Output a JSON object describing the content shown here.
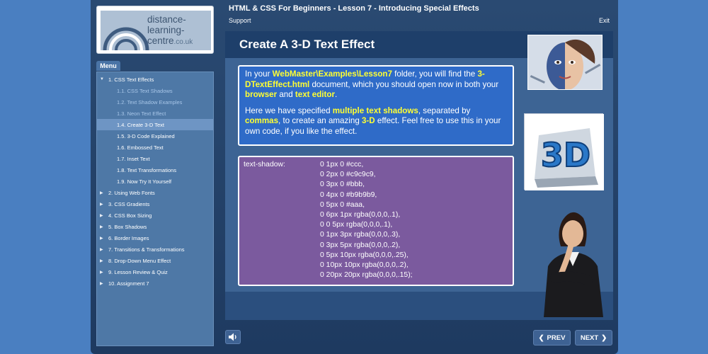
{
  "header": {
    "course_title": "HTML & CSS For Beginners - Lesson 7 - Introducing Special Effects",
    "support_label": "Support",
    "exit_label": "Exit"
  },
  "logo": {
    "line1": "distance-",
    "line2": "learning-",
    "line3": "centre",
    "suffix": ".co.uk"
  },
  "menu": {
    "tab_label": "Menu",
    "items": [
      {
        "label": "1. CSS Text Effects",
        "level": 0,
        "expanded": true
      },
      {
        "label": "1.1. CSS Text Shadows",
        "level": 1
      },
      {
        "label": "1.2. Text Shadow Examples",
        "level": 1
      },
      {
        "label": "1.3. Neon Text Effect",
        "level": 1
      },
      {
        "label": "1.4. Create 3-D Text",
        "level": 1,
        "active": true
      },
      {
        "label": "1.5. 3-D Code Explained",
        "level": 1
      },
      {
        "label": "1.6. Embossed Text",
        "level": 1
      },
      {
        "label": "1.7. Inset Text",
        "level": 1
      },
      {
        "label": "1.8. Text Transformations",
        "level": 1
      },
      {
        "label": "1.9. Now Try It Yourself",
        "level": 1
      },
      {
        "label": "2. Using Web Fonts",
        "level": 0
      },
      {
        "label": "3. CSS Gradients",
        "level": 0
      },
      {
        "label": "4. CSS Box Sizing",
        "level": 0
      },
      {
        "label": "5. Box Shadows",
        "level": 0
      },
      {
        "label": "6. Border Images",
        "level": 0
      },
      {
        "label": "7. Transitions & Transformations",
        "level": 0
      },
      {
        "label": "8. Drop-Down Menu Effect",
        "level": 0
      },
      {
        "label": "9. Lesson Review & Quiz",
        "level": 0
      },
      {
        "label": "10. Assignment 7",
        "level": 0
      }
    ]
  },
  "slide": {
    "title": "Create A 3-D Text Effect",
    "para1": [
      {
        "t": "In your ",
        "hl": false
      },
      {
        "t": "WebMaster\\Examples\\Lesson7",
        "hl": true
      },
      {
        "t": " folder, you will find the ",
        "hl": false
      },
      {
        "t": "3-DTextEffect.html",
        "hl": true
      },
      {
        "t": " document, which you should open now in both your ",
        "hl": false
      },
      {
        "t": "browser",
        "hl": true
      },
      {
        "t": " and ",
        "hl": false
      },
      {
        "t": "text editor",
        "hl": true
      },
      {
        "t": ".",
        "hl": false
      }
    ],
    "para2": [
      {
        "t": "Here we have specified ",
        "hl": false
      },
      {
        "t": "multiple text shadows",
        "hl": true
      },
      {
        "t": ", separated by ",
        "hl": false
      },
      {
        "t": "commas",
        "hl": true
      },
      {
        "t": ", to create an amazing ",
        "hl": false
      },
      {
        "t": "3-D",
        "hl": true
      },
      {
        "t": " effect. Feel free to use this in your own code, if you like the effect.",
        "hl": false
      }
    ],
    "code": {
      "property": "text-shadow:",
      "lines": [
        "0 1px 0 #ccc,",
        "0 2px 0 #c9c9c9,",
        "0 3px 0 #bbb,",
        "0 4px 0 #b9b9b9,",
        "0 5px 0 #aaa,",
        "0 6px 1px rgba(0,0,0,.1),",
        "0 0 5px rgba(0,0,0,.1),",
        "0 1px 3px rgba(0,0,0,.3),",
        "0 3px 5px rgba(0,0,0,.2),",
        "0 5px 10px rgba(0,0,0,.25),",
        "0 10px 10px rgba(0,0,0,.2),",
        "0 20px 20px rgba(0,0,0,.15);"
      ]
    },
    "graphic_label": "3D"
  },
  "nav": {
    "prev_label": "PREV",
    "next_label": "NEXT",
    "sound_icon": "speaker-icon"
  }
}
